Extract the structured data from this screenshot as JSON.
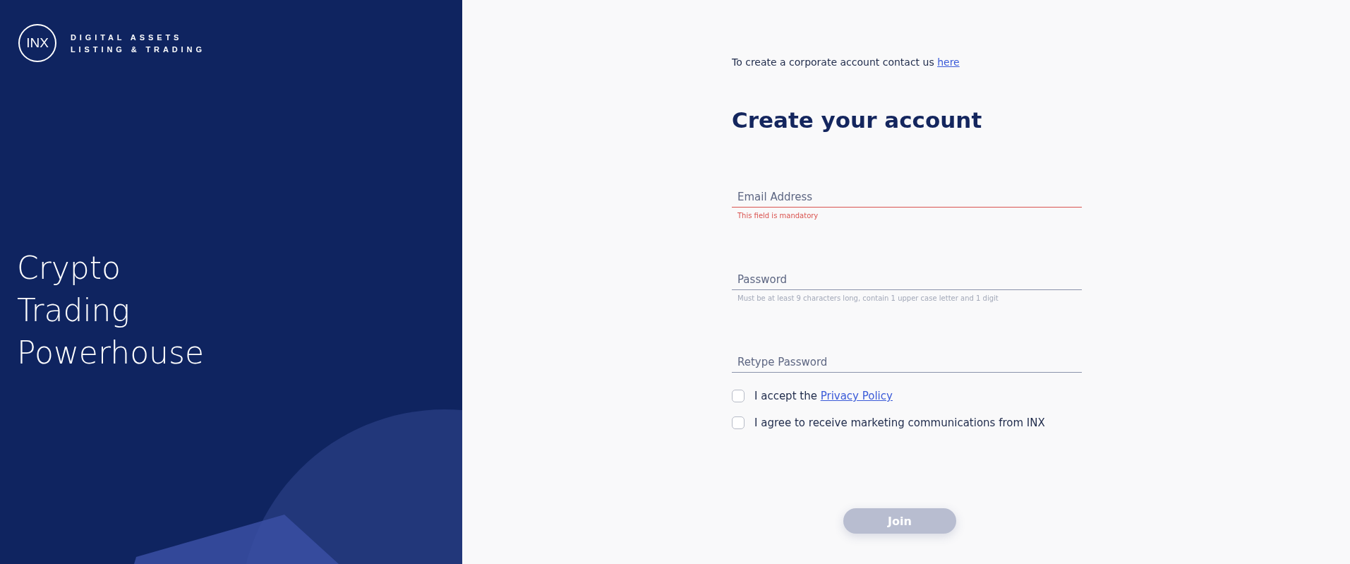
{
  "brand": {
    "logo": "INX",
    "tagline_lines": [
      "DIGITAL ASSETS",
      "LISTING & TRADING"
    ]
  },
  "headline_lines": [
    "Crypto",
    "Trading",
    "Powerhouse"
  ],
  "corporate_note": {
    "text": "To create a corporate account contact us",
    "link": "here"
  },
  "title": "Create your account",
  "fields": [
    {
      "placeholder": "Email Address",
      "error": true,
      "message": "This field is mandatory"
    },
    {
      "placeholder": "Password",
      "error": false,
      "message": "Must be at least 9 characters long, contain 1 upper case letter and 1 digit"
    },
    {
      "placeholder": "Retype Password",
      "error": false
    }
  ],
  "checkboxes": [
    {
      "text": "I accept the",
      "link": "Privacy Policy",
      "checked": false
    },
    {
      "text": "I agree to receive marketing communications from INX",
      "checked": false
    }
  ],
  "join_button": {
    "label": "Join",
    "disabled": true
  }
}
